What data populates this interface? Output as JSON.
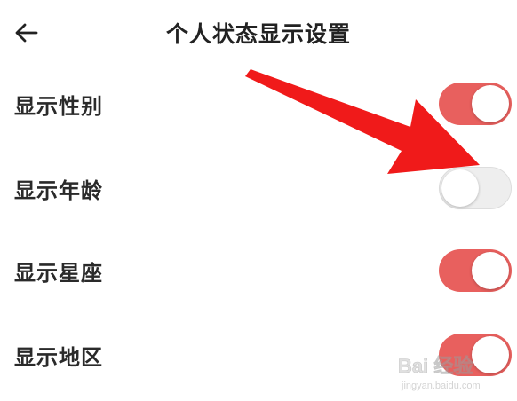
{
  "header": {
    "title": "个人状态显示设置",
    "back_icon": "arrow-left-icon"
  },
  "settings": [
    {
      "label": "显示性别",
      "enabled": true
    },
    {
      "label": "显示年龄",
      "enabled": false
    },
    {
      "label": "显示星座",
      "enabled": true
    },
    {
      "label": "显示地区",
      "enabled": true
    }
  ],
  "annotation": {
    "color": "#f01a1a",
    "icon": "red-arrow-pointer"
  },
  "watermark": {
    "main_text": "Bai 经验",
    "sub_text": "jingyan.baidu.com"
  },
  "colors": {
    "toggle_on": "#e8605e",
    "toggle_off": "#eeeeee",
    "text": "#2a2a2a"
  }
}
